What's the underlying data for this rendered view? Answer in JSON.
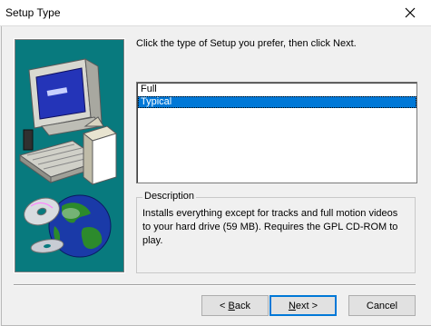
{
  "window": {
    "title": "Setup Type"
  },
  "content": {
    "prompt": "Click the type of Setup you prefer, then click Next.",
    "setup_types": [
      {
        "label": "Full",
        "selected": false
      },
      {
        "label": "Typical",
        "selected": true
      }
    ],
    "description": {
      "legend": "Description",
      "text": "Installs everything except for tracks and full motion videos to your hard drive (59 MB).  Requires the GPL CD-ROM to play."
    }
  },
  "buttons": {
    "back": {
      "prefix": "< ",
      "mnemonic": "B",
      "rest": "ack"
    },
    "next": {
      "mnemonic": "N",
      "rest": "ext",
      "suffix": " >"
    },
    "cancel": "Cancel"
  },
  "colors": {
    "art_background": "#087a7e",
    "selection": "#0078d7"
  }
}
